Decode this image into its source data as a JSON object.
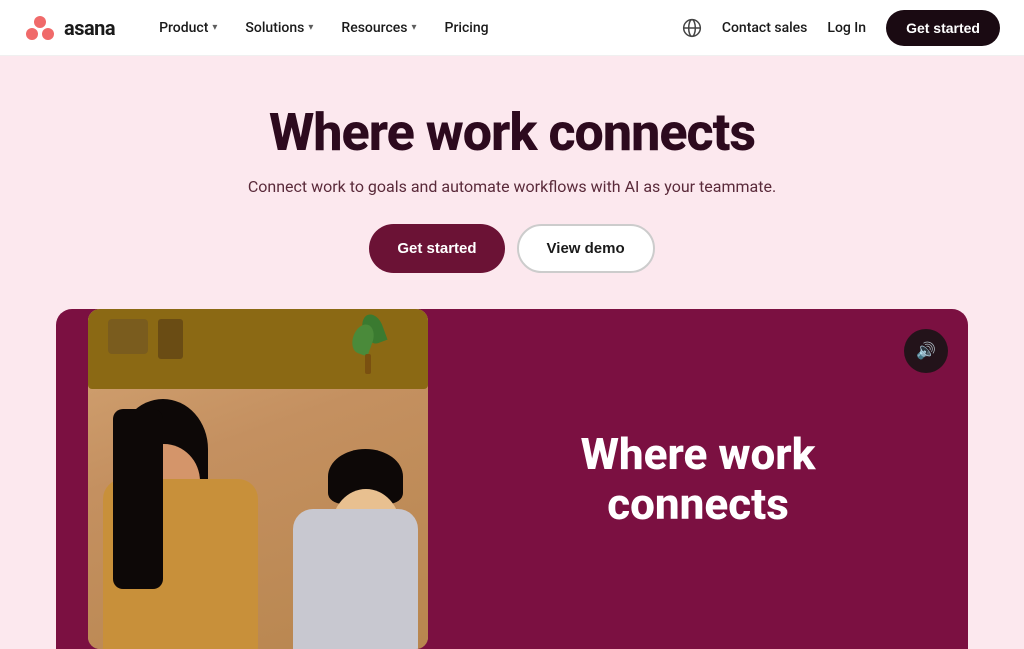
{
  "brand": {
    "name": "asana",
    "logo_alt": "Asana logo"
  },
  "nav": {
    "links": [
      {
        "label": "Product",
        "has_dropdown": true
      },
      {
        "label": "Solutions",
        "has_dropdown": true
      },
      {
        "label": "Resources",
        "has_dropdown": true
      },
      {
        "label": "Pricing",
        "has_dropdown": false
      }
    ],
    "contact_sales": "Contact sales",
    "login": "Log In",
    "get_started": "Get started"
  },
  "hero": {
    "title": "Where work connects",
    "subtitle": "Connect work to goals and automate workflows with AI as your teammate.",
    "btn_get_started": "Get started",
    "btn_view_demo": "View demo"
  },
  "video": {
    "title_line1": "Where work",
    "title_line2": "connects",
    "sound_icon": "🔊"
  }
}
